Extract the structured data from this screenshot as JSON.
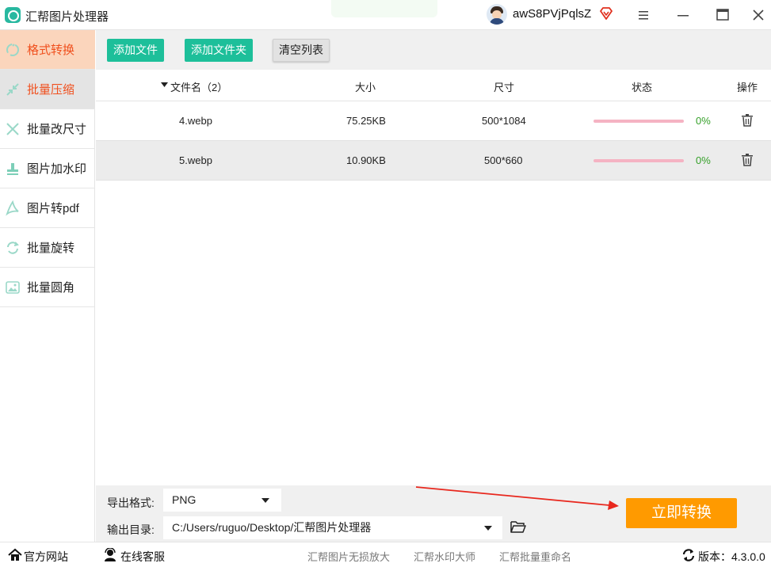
{
  "app": {
    "title": "汇帮图片处理器",
    "username": "awS8PVjPqlsZ"
  },
  "colors": {
    "accent_green": "#1dbf9a",
    "active_text": "#f0501e",
    "convert_orange": "#ff9a00",
    "percent_green": "#36a02a",
    "progress_track": "#f5b3c3"
  },
  "sidebar": {
    "items": [
      {
        "label": "格式转换",
        "icon": "convert-icon",
        "state": "active"
      },
      {
        "label": "批量压缩",
        "icon": "compress-icon",
        "state": "hover"
      },
      {
        "label": "批量改尺寸",
        "icon": "resize-icon",
        "state": "normal"
      },
      {
        "label": "图片加水印",
        "icon": "stamp-icon",
        "state": "normal"
      },
      {
        "label": "图片转pdf",
        "icon": "pdf-icon",
        "state": "normal"
      },
      {
        "label": "批量旋转",
        "icon": "rotate-icon",
        "state": "normal"
      },
      {
        "label": "批量圆角",
        "icon": "image-icon",
        "state": "normal"
      }
    ]
  },
  "toolbar": {
    "add_file": "添加文件",
    "add_folder": "添加文件夹",
    "clear_list": "清空列表"
  },
  "table": {
    "headers": {
      "name": "文件名（2）",
      "size": "大小",
      "dimensions": "尺寸",
      "status": "状态",
      "action": "操作"
    },
    "rows": [
      {
        "name": "4.webp",
        "size": "75.25KB",
        "dimensions": "500*1084",
        "progress": 0,
        "percent": "0%"
      },
      {
        "name": "5.webp",
        "size": "10.90KB",
        "dimensions": "500*660",
        "progress": 0,
        "percent": "0%"
      }
    ]
  },
  "settings": {
    "format_label": "导出格式:",
    "format_value": "PNG",
    "dir_label": "输出目录:",
    "dir_value": "C:/Users/ruguo/Desktop/汇帮图片处理器",
    "convert_label": "立即转换"
  },
  "statusbar": {
    "website": "官方网站",
    "support": "在线客服",
    "link1": "汇帮图片无损放大",
    "link2": "汇帮水印大师",
    "link3": "汇帮批量重命名",
    "version": "版本：4.3.0.0"
  }
}
